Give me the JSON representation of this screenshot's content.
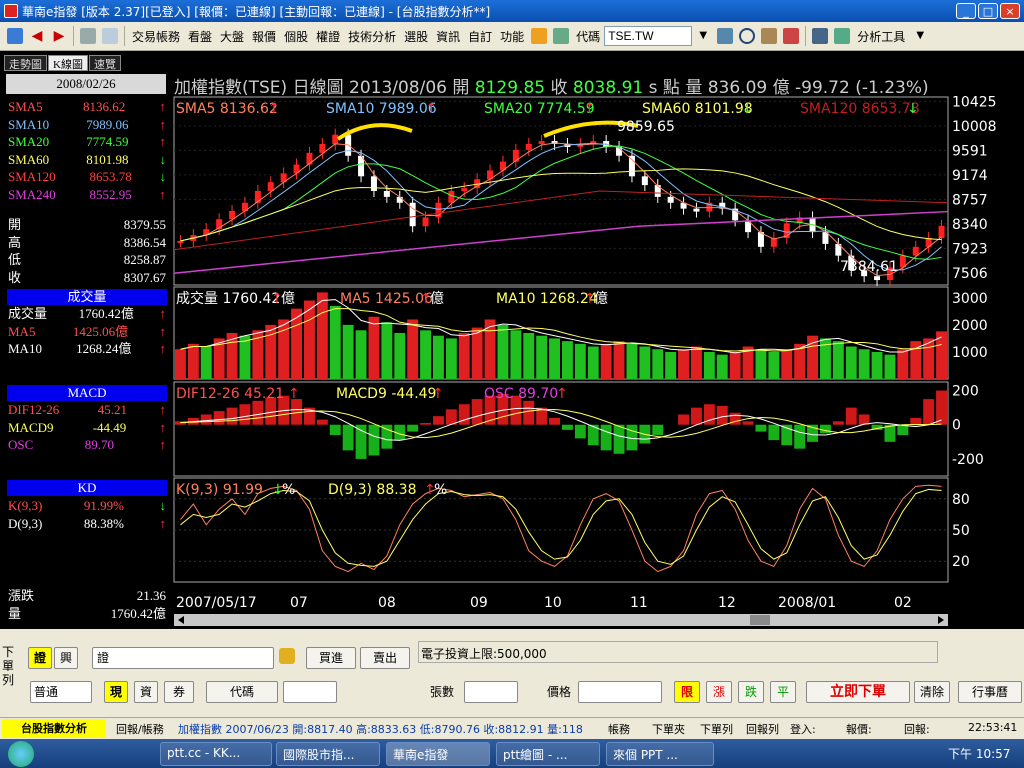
{
  "window": {
    "title": "華南e指發 [版本 2.37][已登入] [報價：已連線] [主動回報：已連線] - [台股指數分析**]",
    "controls": [
      "_",
      "□",
      "×"
    ]
  },
  "menu": {
    "items": [
      "交易帳務",
      "看盤",
      "大盤",
      "報價",
      "個股",
      "權證",
      "技術分析",
      "選股",
      "資訊",
      "自訂",
      "功能"
    ],
    "code_label": "代碼",
    "code_value": "TSE.TW",
    "analysis_tools": "分析工具"
  },
  "left": {
    "tabs": [
      "走勢圖",
      "K線圖",
      "速覽"
    ],
    "date": "2008/02/26",
    "sma": [
      {
        "name": "SMA5",
        "value": "8136.62",
        "dir": "↑",
        "color": "#ff5050"
      },
      {
        "name": "SMA10",
        "value": "7989.06",
        "dir": "↑",
        "color": "#80c0ff"
      },
      {
        "name": "SMA20",
        "value": "7774.59",
        "dir": "↑",
        "color": "#40ff40"
      },
      {
        "name": "SMA60",
        "value": "8101.98",
        "dir": "↓",
        "color": "#ffff60"
      },
      {
        "name": "SMA120",
        "value": "8653.78",
        "dir": "↓",
        "color": "#ff4040"
      },
      {
        "name": "SMA240",
        "value": "8552.95",
        "dir": "↑",
        "color": "#e040e0"
      }
    ],
    "ohlc": [
      {
        "name": "開",
        "value": "8379.55"
      },
      {
        "name": "高",
        "value": "8386.54"
      },
      {
        "name": "低",
        "value": "8258.87"
      },
      {
        "name": "收",
        "value": "8307.67"
      }
    ],
    "volume_header": "成交量",
    "volume": [
      {
        "name": "成交量",
        "value": "1760.42億",
        "dir": "↑",
        "color": "#ffffff"
      },
      {
        "name": "MA5",
        "value": "1425.06億",
        "dir": "↑",
        "color": "#ff5050"
      },
      {
        "name": "MA10",
        "value": "1268.24億",
        "dir": "↑",
        "color": "#ffffff"
      }
    ],
    "macd_header": "MACD",
    "macd": [
      {
        "name": "DIF12-26",
        "value": "45.21",
        "dir": "↑",
        "color": "#ff5050"
      },
      {
        "name": "MACD9",
        "value": "-44.49",
        "dir": "↑",
        "color": "#ffff60"
      },
      {
        "name": "OSC",
        "value": "89.70",
        "dir": "↑",
        "color": "#e040e0"
      }
    ],
    "kd_header": "KD",
    "kd": [
      {
        "name": "K(9,3)",
        "value": "91.99%",
        "dir": "↓",
        "color": "#ff5050"
      },
      {
        "name": "D(9,3)",
        "value": "88.38%",
        "dir": "↑",
        "color": "#ffffff"
      }
    ],
    "footer": [
      {
        "name": "漲跌",
        "value": "21.36"
      },
      {
        "name": "量",
        "value": "1760.42億"
      }
    ]
  },
  "headline": {
    "name": "加權指數(TSE)",
    "period": "日線圖",
    "date": "2013/08/06",
    "open_label": "開",
    "open": "8129.85",
    "close_label": "收",
    "close": "8038.91",
    "unit": "s 點",
    "vol_label": "量",
    "vol": "836.09 億",
    "change": "-99.72 (-1.23%)"
  },
  "colors": {
    "up": "#e02020",
    "down": "#20c020",
    "sma5": "#ff8060",
    "sma10": "#80c0ff",
    "sma20": "#40ff40",
    "sma60": "#ffff60",
    "sma120": "#c02020",
    "sma240": "#d040d0"
  },
  "chart_data": [
    {
      "type": "line",
      "title": "SMA5 8136.62↑  SMA10 7989.06↑  SMA20 7774.59↑  SMA60 8101.98↓  SMA120 8653.78↓",
      "legend": [
        {
          "name": "SMA5",
          "value": "8136.62",
          "dir": "↑",
          "color": "#ff8060"
        },
        {
          "name": "SMA10",
          "value": "7989.06",
          "dir": "↑",
          "color": "#80c0ff"
        },
        {
          "name": "SMA20",
          "value": "7774.59",
          "dir": "↑",
          "color": "#40ff40"
        },
        {
          "name": "SMA60",
          "value": "8101.98",
          "dir": "↓",
          "color": "#ffff60"
        },
        {
          "name": "SMA120",
          "value": "8653.78",
          "dir": "↓",
          "color": "#c02020"
        }
      ],
      "y_ticks": [
        "10425",
        "10008",
        "9591",
        "9174",
        "8757",
        "8340",
        "7923",
        "7506"
      ],
      "ylim": [
        7300,
        10500
      ],
      "annotations": [
        "9859.65",
        "7384.61"
      ],
      "price_path": [
        8050,
        8150,
        8250,
        8420,
        8560,
        8700,
        8900,
        9050,
        9200,
        9350,
        9550,
        9700,
        9859,
        9500,
        9150,
        8900,
        8800,
        8700,
        8300,
        8450,
        8700,
        8900,
        8950,
        9100,
        9250,
        9400,
        9600,
        9700,
        9750,
        9700,
        9650,
        9700,
        9750,
        9650,
        9500,
        9150,
        9000,
        8800,
        8700,
        8600,
        8550,
        8700,
        8600,
        8400,
        8200,
        7950,
        8100,
        8350,
        8450,
        8200,
        8000,
        7800,
        7550,
        7450,
        7384,
        7600,
        7800,
        7950,
        8100,
        8307
      ]
    },
    {
      "type": "bar",
      "title": "成交量 1760.42↑億  MA5 1425.06↑億  MA10 1268.24↑億",
      "legend": [
        {
          "name": "成交量",
          "value": "1760.42",
          "dir": "↑",
          "unit": "億",
          "color": "#ffffff"
        },
        {
          "name": "MA5",
          "value": "1425.06",
          "dir": "↑",
          "unit": "億",
          "color": "#ff8060"
        },
        {
          "name": "MA10",
          "value": "1268.24",
          "dir": "↑",
          "unit": "億",
          "color": "#ffff60"
        }
      ],
      "y_ticks": [
        "3000",
        "2000",
        "1000"
      ],
      "ylim": [
        0,
        3400
      ],
      "values": [
        1100,
        1300,
        1200,
        1500,
        1700,
        1600,
        1800,
        2000,
        2200,
        2600,
        2900,
        3200,
        2700,
        2000,
        1800,
        2300,
        2100,
        1700,
        2200,
        1800,
        1600,
        1500,
        1700,
        1900,
        2200,
        2000,
        1800,
        1700,
        1600,
        1500,
        1400,
        1300,
        1200,
        1300,
        1400,
        1300,
        1200,
        1100,
        1000,
        1100,
        1200,
        1000,
        900,
        1000,
        1200,
        1100,
        1000,
        1100,
        1300,
        1600,
        1500,
        1400,
        1200,
        1100,
        1000,
        900,
        1100,
        1400,
        1500,
        1760
      ]
    },
    {
      "type": "bar",
      "title": "DIF12-26 45.21↑  MACD9 -44.49↑  OSC 89.70↑",
      "legend": [
        {
          "name": "DIF12-26",
          "value": "45.21",
          "dir": "↑",
          "color": "#ff5050"
        },
        {
          "name": "MACD9",
          "value": "-44.49",
          "dir": "↑",
          "color": "#ffff60"
        },
        {
          "name": "OSC",
          "value": "89.70",
          "dir": "↑",
          "color": "#e040e0"
        }
      ],
      "y_ticks": [
        "200",
        "0",
        "-200"
      ],
      "ylim": [
        -300,
        250
      ],
      "values": [
        20,
        40,
        60,
        80,
        100,
        120,
        140,
        160,
        170,
        150,
        100,
        30,
        -60,
        -150,
        -200,
        -180,
        -140,
        -90,
        -40,
        10,
        50,
        90,
        120,
        150,
        170,
        180,
        170,
        140,
        100,
        40,
        -30,
        -80,
        -120,
        -150,
        -170,
        -150,
        -110,
        -60,
        0,
        60,
        100,
        120,
        110,
        70,
        20,
        -40,
        -90,
        -120,
        -140,
        -100,
        -50,
        20,
        100,
        60,
        -30,
        -100,
        -60,
        40,
        150,
        200
      ]
    },
    {
      "type": "line",
      "title": "K(9,3) 91.99↓%  D(9,3) 88.38↑%",
      "legend": [
        {
          "name": "K(9,3)",
          "value": "91.99",
          "dir": "↓",
          "unit": "%",
          "color": "#ff8060"
        },
        {
          "name": "D(9,3)",
          "value": "88.38",
          "dir": "↑",
          "unit": "%",
          "color": "#ffff60"
        }
      ],
      "y_ticks": [
        "80",
        "50",
        "20"
      ],
      "ylim": [
        0,
        100
      ],
      "series": [
        {
          "values": [
            60,
            75,
            55,
            70,
            80,
            65,
            85,
            90,
            92,
            88,
            70,
            30,
            15,
            10,
            18,
            12,
            25,
            55,
            75,
            85,
            90,
            88,
            82,
            84,
            86,
            80,
            60,
            30,
            20,
            15,
            25,
            55,
            80,
            85,
            78,
            50,
            20,
            10,
            15,
            30,
            65,
            85,
            88,
            70,
            40,
            20,
            15,
            35,
            70,
            90,
            80,
            45,
            20,
            15,
            30,
            60,
            80,
            92,
            93,
            92
          ]
        },
        {
          "values": [
            55,
            65,
            62,
            65,
            75,
            72,
            78,
            85,
            88,
            87,
            78,
            50,
            28,
            18,
            16,
            15,
            20,
            40,
            60,
            75,
            85,
            87,
            84,
            83,
            84,
            82,
            70,
            48,
            30,
            22,
            24,
            40,
            65,
            78,
            80,
            65,
            38,
            20,
            17,
            25,
            50,
            72,
            82,
            77,
            55,
            32,
            22,
            28,
            55,
            78,
            82,
            62,
            35,
            22,
            26,
            45,
            68,
            85,
            89,
            88
          ]
        }
      ]
    }
  ],
  "x_labels": [
    "2007/05/17",
    "07",
    "08",
    "09",
    "10",
    "11",
    "12",
    "2008/01",
    "02"
  ],
  "order": {
    "left_labels": [
      "證",
      "興"
    ],
    "code_field": "證",
    "buy": "買進",
    "sell": "賣出",
    "credit": "電子投資上限:500,000",
    "order_type": "普通",
    "modes": [
      "現",
      "資",
      "券"
    ],
    "code_label": "代碼",
    "qty_label": "張數",
    "price_label": "價格",
    "limit": "限",
    "up": "漲",
    "down": "跌",
    "flat": "平",
    "submit": "立即下單",
    "clear": "清除",
    "calendar": "行事曆",
    "side_label": "下單列"
  },
  "status": {
    "tab1": "台股指數分析",
    "tab2": "回報/帳務",
    "ticker": "加權指數 2007/06/23 開:8817.40 高:8833.63 低:8790.76 收:8812.91 量:118",
    "buttons": [
      "帳務",
      "下單夾",
      "下單列",
      "回報列"
    ],
    "login": "登入:",
    "quote": "報價:",
    "report": "回報:",
    "time": "22:53:41"
  },
  "taskbar": {
    "items": [
      "ptt.cc - KK...",
      "國際股市指...",
      "華南e指發",
      "ptt繪圖 - ...",
      "來個 PPT ..."
    ],
    "clock": "下午 10:57"
  }
}
